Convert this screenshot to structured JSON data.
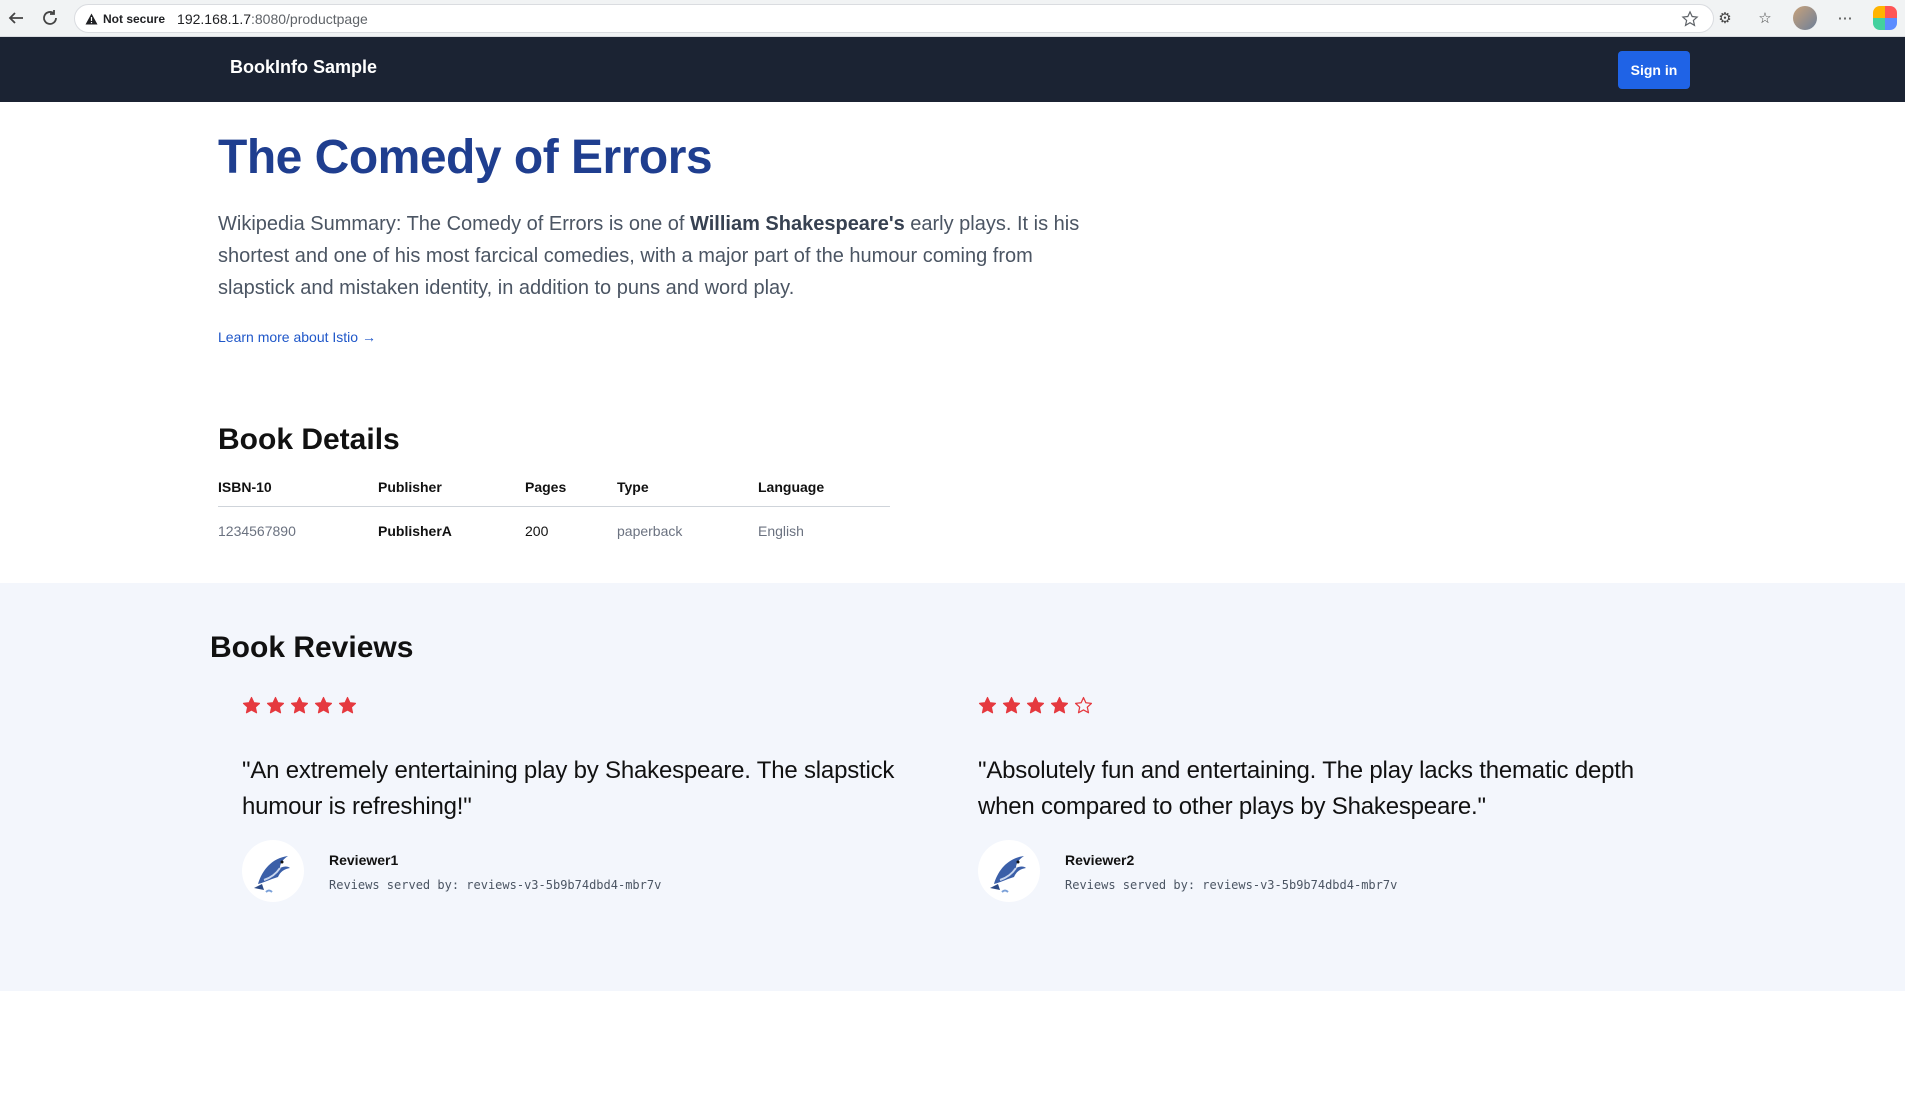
{
  "browser": {
    "security_label": "Not secure",
    "url_host": "192.168.1.7",
    "url_path": ":8080/productpage"
  },
  "header": {
    "brand": "BookInfo Sample",
    "signin_label": "Sign in"
  },
  "hero": {
    "title": "The Comedy of Errors",
    "summary_prefix": "Wikipedia Summary: The Comedy of Errors is one of ",
    "summary_bold": "William Shakespeare's",
    "summary_suffix": " early plays. It is his shortest and one of his most farcical comedies, with a major part of the humour coming from slapstick and mistaken identity, in addition to puns and word play.",
    "learn_more": "Learn more about Istio →"
  },
  "details": {
    "title": "Book Details",
    "columns": [
      "ISBN-10",
      "Publisher",
      "Pages",
      "Type",
      "Language"
    ],
    "row": [
      "1234567890",
      "PublisherA",
      "200",
      "paperback",
      "English"
    ]
  },
  "reviews": {
    "title": "Book Reviews",
    "star_color": "#e5393f",
    "items": [
      {
        "rating": 5,
        "max": 5,
        "text": "\"An extremely entertaining play by Shakespeare. The slapstick humour is refreshing!\"",
        "reviewer": "Reviewer1",
        "served_by": "Reviews served by: reviews-v3-5b9b74dbd4-mbr7v"
      },
      {
        "rating": 4,
        "max": 5,
        "text": "\"Absolutely fun and entertaining. The play lacks thematic depth when compared to other plays by Shakespeare.\"",
        "reviewer": "Reviewer2",
        "served_by": "Reviews served by: reviews-v3-5b9b74dbd4-mbr7v"
      }
    ]
  }
}
